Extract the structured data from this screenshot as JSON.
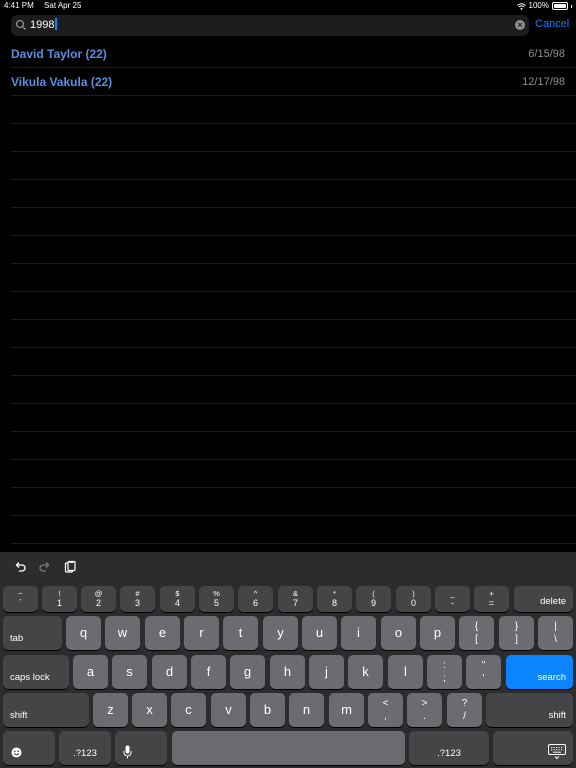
{
  "status": {
    "time": "4:41 PM",
    "date": "Sat Apr 25",
    "battery": "100%"
  },
  "search": {
    "query": "1998",
    "cancel_label": "Cancel"
  },
  "results": [
    {
      "name": "David Taylor (22)",
      "date": "6/15/98"
    },
    {
      "name": "Vikula Vakula (22)",
      "date": "12/17/98"
    }
  ],
  "keyboard": {
    "number_row": [
      {
        "top": "~",
        "bottom": "`"
      },
      {
        "top": "!",
        "bottom": "1"
      },
      {
        "top": "@",
        "bottom": "2"
      },
      {
        "top": "#",
        "bottom": "3"
      },
      {
        "top": "$",
        "bottom": "4"
      },
      {
        "top": "%",
        "bottom": "5"
      },
      {
        "top": "^",
        "bottom": "6"
      },
      {
        "top": "&",
        "bottom": "7"
      },
      {
        "top": "*",
        "bottom": "8"
      },
      {
        "top": "(",
        "bottom": "9"
      },
      {
        "top": ")",
        "bottom": "0"
      },
      {
        "top": "_",
        "bottom": "-"
      },
      {
        "top": "+",
        "bottom": "="
      }
    ],
    "delete_label": "delete",
    "tab_label": "tab",
    "row_q": [
      "q",
      "w",
      "e",
      "r",
      "t",
      "y",
      "u",
      "i",
      "o",
      "p"
    ],
    "row_q_symbols": [
      {
        "top": "{",
        "bottom": "["
      },
      {
        "top": "}",
        "bottom": "]"
      },
      {
        "top": "|",
        "bottom": "\\"
      }
    ],
    "caps_label": "caps lock",
    "row_a": [
      "a",
      "s",
      "d",
      "f",
      "g",
      "h",
      "j",
      "k",
      "l"
    ],
    "row_a_symbols": [
      {
        "top": ":",
        "bottom": ";"
      },
      {
        "top": "\"",
        "bottom": "'"
      }
    ],
    "search_label": "search",
    "shift_label": "shift",
    "row_z": [
      "z",
      "x",
      "c",
      "v",
      "b",
      "n",
      "m"
    ],
    "row_z_symbols": [
      {
        "top": "<",
        "bottom": ","
      },
      {
        "top": ">",
        "bottom": "."
      },
      {
        "top": "?",
        "bottom": "/"
      }
    ],
    "numbers_label": ".?123"
  }
}
